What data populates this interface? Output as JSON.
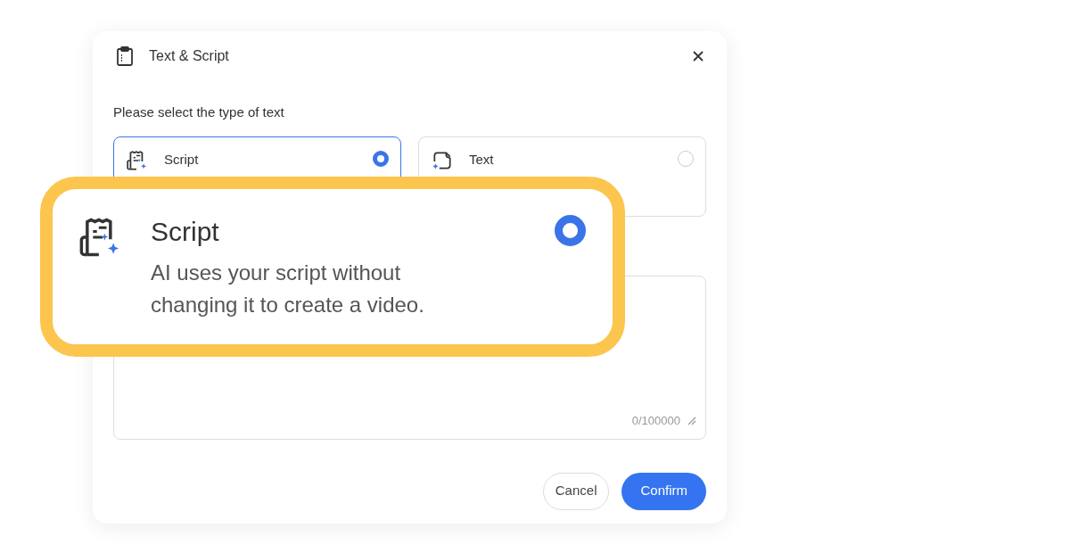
{
  "dialog": {
    "title": "Text & Script",
    "prompt": "Please select the type of text",
    "options": [
      {
        "kind": "script",
        "title": "Script",
        "selected": true
      },
      {
        "kind": "text",
        "title": "Text",
        "selected": false
      }
    ],
    "editor": {
      "counter": "0/100000"
    },
    "buttons": [
      {
        "kind": "secondary",
        "label": "Cancel"
      },
      {
        "kind": "primary",
        "label": "Confirm"
      }
    ]
  },
  "callout": {
    "kind": "script",
    "title": "Script",
    "description": "AI uses your script without changing it to create a video.",
    "selected": true
  }
}
